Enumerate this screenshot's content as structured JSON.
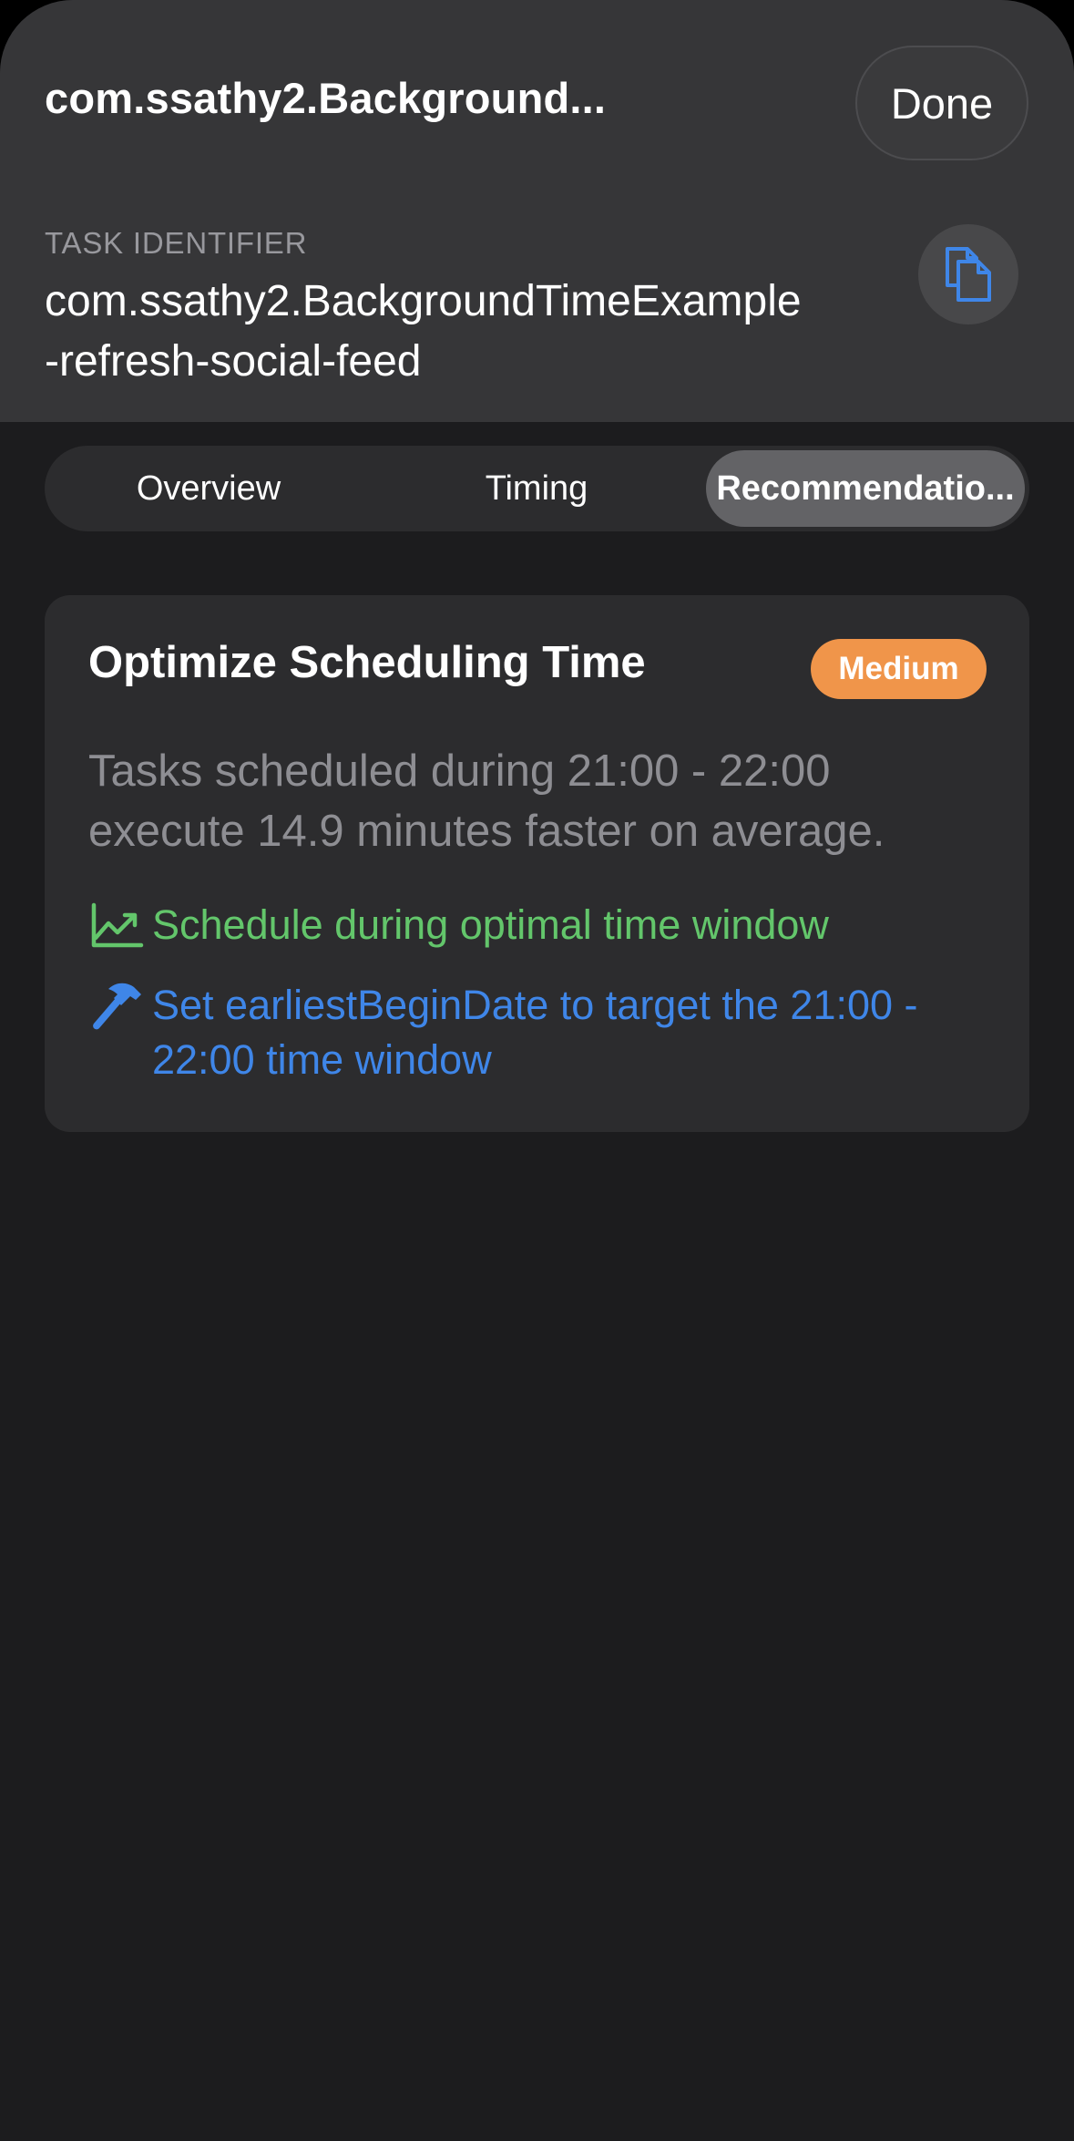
{
  "header": {
    "nav_title": "com.ssathy2.Background...",
    "done_label": "Done",
    "identifier_caption": "TASK IDENTIFIER",
    "identifier_value": "com.ssathy2.BackgroundTimeExample\n-refresh-social-feed",
    "copy_icon": "doc-on-doc-icon"
  },
  "tabs": {
    "items": [
      {
        "label": "Overview"
      },
      {
        "label": "Timing"
      },
      {
        "label": "Recommendatio..."
      }
    ],
    "selected": "Recommendatio..."
  },
  "recommendation": {
    "title": "Optimize Scheduling Time",
    "priority": "Medium",
    "description": "Tasks scheduled during 21:00 - 22:00 execute 14.9 minutes faster on average.",
    "benefit": {
      "icon": "chart-line-uptrend-icon",
      "text": "Schedule during optimal time window"
    },
    "action": {
      "icon": "hammer-icon",
      "text": "Set earliestBeginDate to target the 21:00 - 22:00 time window"
    }
  },
  "colors": {
    "background": "#1c1c1e",
    "header": "#363638",
    "card": "#2c2c2e",
    "badge": "#f0954a",
    "benefit": "#63c66b",
    "action": "#3f86e8",
    "secondary_text": "#8e8e93"
  }
}
